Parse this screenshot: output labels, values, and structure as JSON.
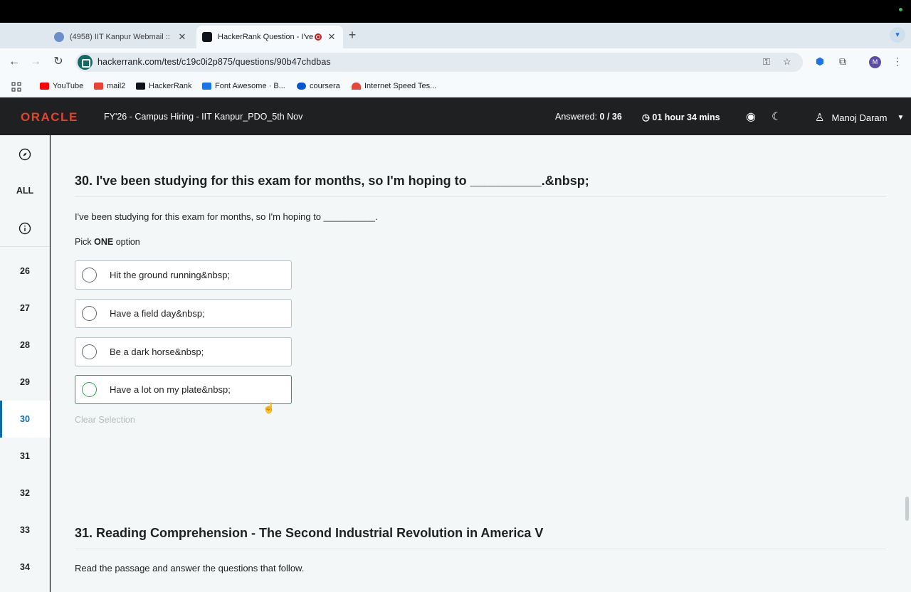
{
  "browser": {
    "tabs": [
      {
        "title": "(4958) IIT Kanpur Webmail :: ",
        "active": false
      },
      {
        "title": "HackerRank Question - I've",
        "active": true
      }
    ],
    "url": "hackerrank.com/test/c19c0i2p875/questions/90b47chdbas",
    "avatar_letter": "M",
    "bookmarks": [
      {
        "label": "YouTube",
        "color": "#ff0000"
      },
      {
        "label": "mail2",
        "color": "#ea4335"
      },
      {
        "label": "HackerRank",
        "color": "#0e141e"
      },
      {
        "label": "Font Awesome · B...",
        "color": "#1a73e8"
      },
      {
        "label": "coursera",
        "color": "#0056d2"
      },
      {
        "label": "Internet Speed Tes...",
        "color": "#e8453c"
      }
    ]
  },
  "header": {
    "logo": "ORACLE",
    "test_name": "FY'26 - Campus Hiring - IIT Kanpur_PDO_5th Nov",
    "answered_label": "Answered:",
    "answered_value": "0 / 36",
    "timer": "01 hour 34 mins",
    "user_name": "Manoj Daram"
  },
  "sidebar": {
    "all_label": "ALL",
    "items": [
      "26",
      "27",
      "28",
      "29",
      "30",
      "31",
      "32",
      "33",
      "34"
    ],
    "active": "30"
  },
  "question": {
    "title": "30. I've been studying for this exam for months, so I'm hoping to __________.&nbsp;",
    "body": "I've been studying for this exam for months, so I'm hoping to __________.",
    "pick_prefix": "Pick",
    "pick_strong": "ONE",
    "pick_suffix": "option",
    "options": [
      "Hit the ground running&nbsp;",
      "Have a field day&nbsp;",
      "Be a dark horse&nbsp;",
      "Have a lot on my plate&nbsp;"
    ],
    "clear_label": "Clear Selection"
  },
  "next_question": {
    "title": "31. Reading Comprehension - The Second Industrial Revolution in America V",
    "body": "Read the passage and answer the questions that follow."
  },
  "colors": {
    "header_bg": "#1e2022",
    "oracle_red": "#e2452d",
    "active_blue": "#0e6ba8",
    "hover_green": "#1ba94c"
  }
}
